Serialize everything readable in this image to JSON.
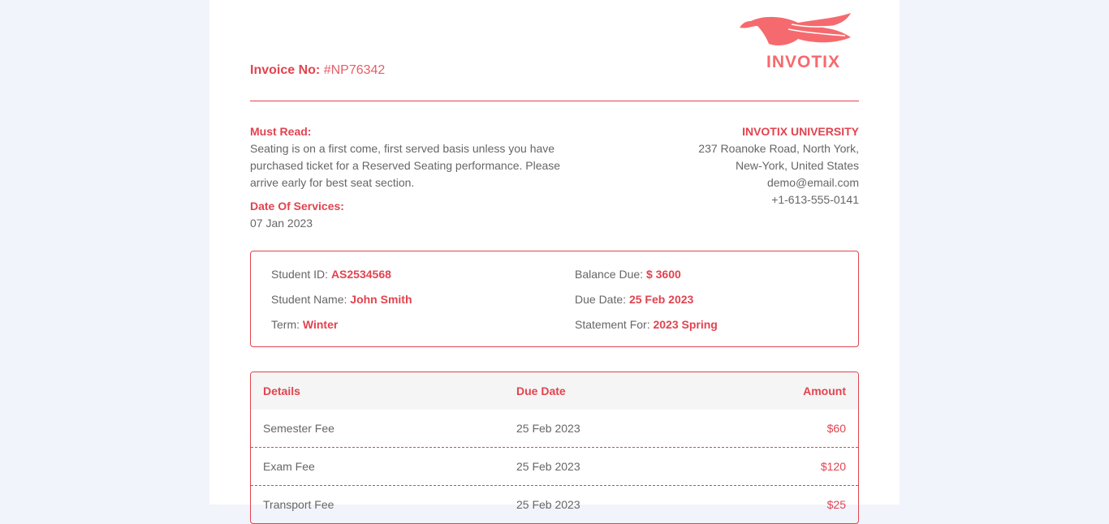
{
  "header": {
    "invoice_label": "Invoice No:",
    "invoice_number": "#NP76342",
    "logo_text": "INVOTIX"
  },
  "notice": {
    "title": "Must Read:",
    "text_lines": [
      "Seating is on a first come, first served basis unless you have",
      "purchased ticket for a Reserved Seating performance. Please",
      "arrive early for best seat section."
    ],
    "date_label": "Date Of Services:",
    "date_value": "07 Jan 2023"
  },
  "organization": {
    "name": "INVOTIX UNIVERSITY",
    "address_line1": "237 Roanoke Road, North York,",
    "address_line2": "New-York, United States",
    "email": "demo@email.com",
    "phone": "+1-613-555-0141"
  },
  "student": {
    "id_label": "Student ID:",
    "id_value": "AS2534568",
    "name_label": "Student Name:",
    "name_value": "John Smith",
    "term_label": "Term:",
    "term_value": "Winter",
    "balance_label": "Balance Due:",
    "balance_value": "$ 3600",
    "due_label": "Due Date:",
    "due_value": "25 Feb 2023",
    "statement_label": "Statement For:",
    "statement_value": "2023 Spring"
  },
  "table": {
    "headers": [
      "Details",
      "Due Date",
      "Amount"
    ],
    "rows": [
      [
        "Semester Fee",
        "25 Feb 2023",
        "$60"
      ],
      [
        "Exam Fee",
        "25 Feb 2023",
        "$120"
      ],
      [
        "Transport Fee",
        "25 Feb 2023",
        "$25"
      ]
    ]
  },
  "colors": {
    "accent": "#e2434f",
    "logo": "#f56a6e",
    "page_background": "#f1f4fb",
    "table_header_background": "#f5f5f5"
  }
}
